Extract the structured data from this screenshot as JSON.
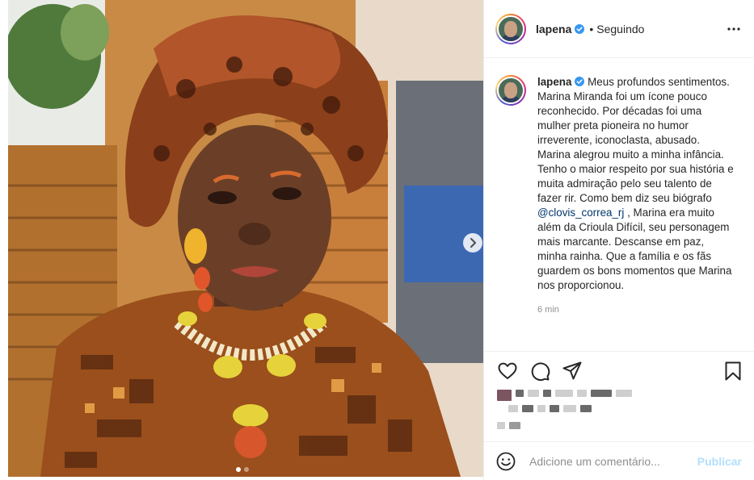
{
  "post": {
    "username": "lapena",
    "verified": true,
    "separator": "•",
    "follow_status": "Seguindo",
    "more_icon": "more-horizontal-icon"
  },
  "media": {
    "next_icon": "chevron-right-icon",
    "slides_total": 2,
    "active_slide": 1
  },
  "caption": {
    "username": "lapena",
    "text_before_mention": " Meus profundos sentimentos. Marina Miranda foi um ícone pouco reconhecido. Por décadas foi uma mulher preta pioneira no humor irreverente, iconoclasta, abusado. Marina alegrou muito a minha infância. Tenho o maior respeito por sua história e muita admiração pelo seu talento de fazer rir. Como bem diz seu biógrafo ",
    "mention": "@clovis_correa_rj",
    "text_after_mention": " , Marina era muito além da Crioula Difícil, seu personagem mais marcante. Descanse em paz, minha rainha. Que a família e os fãs guardem os bons momentos que Marina nos proporcionou.",
    "time": "6 min"
  },
  "actions": {
    "like_icon": "heart-icon",
    "comment_icon": "comment-icon",
    "share_icon": "paper-plane-icon",
    "save_icon": "bookmark-icon"
  },
  "comment_box": {
    "emoji_icon": "smiley-icon",
    "placeholder": "Adicione um comentário...",
    "publish_label": "Publicar"
  },
  "colors": {
    "text": "#262626",
    "muted": "#8e8e8e",
    "link": "#00376b",
    "verified": "#3897f0",
    "publish_disabled": "#b2dffc",
    "border": "#efefef"
  }
}
